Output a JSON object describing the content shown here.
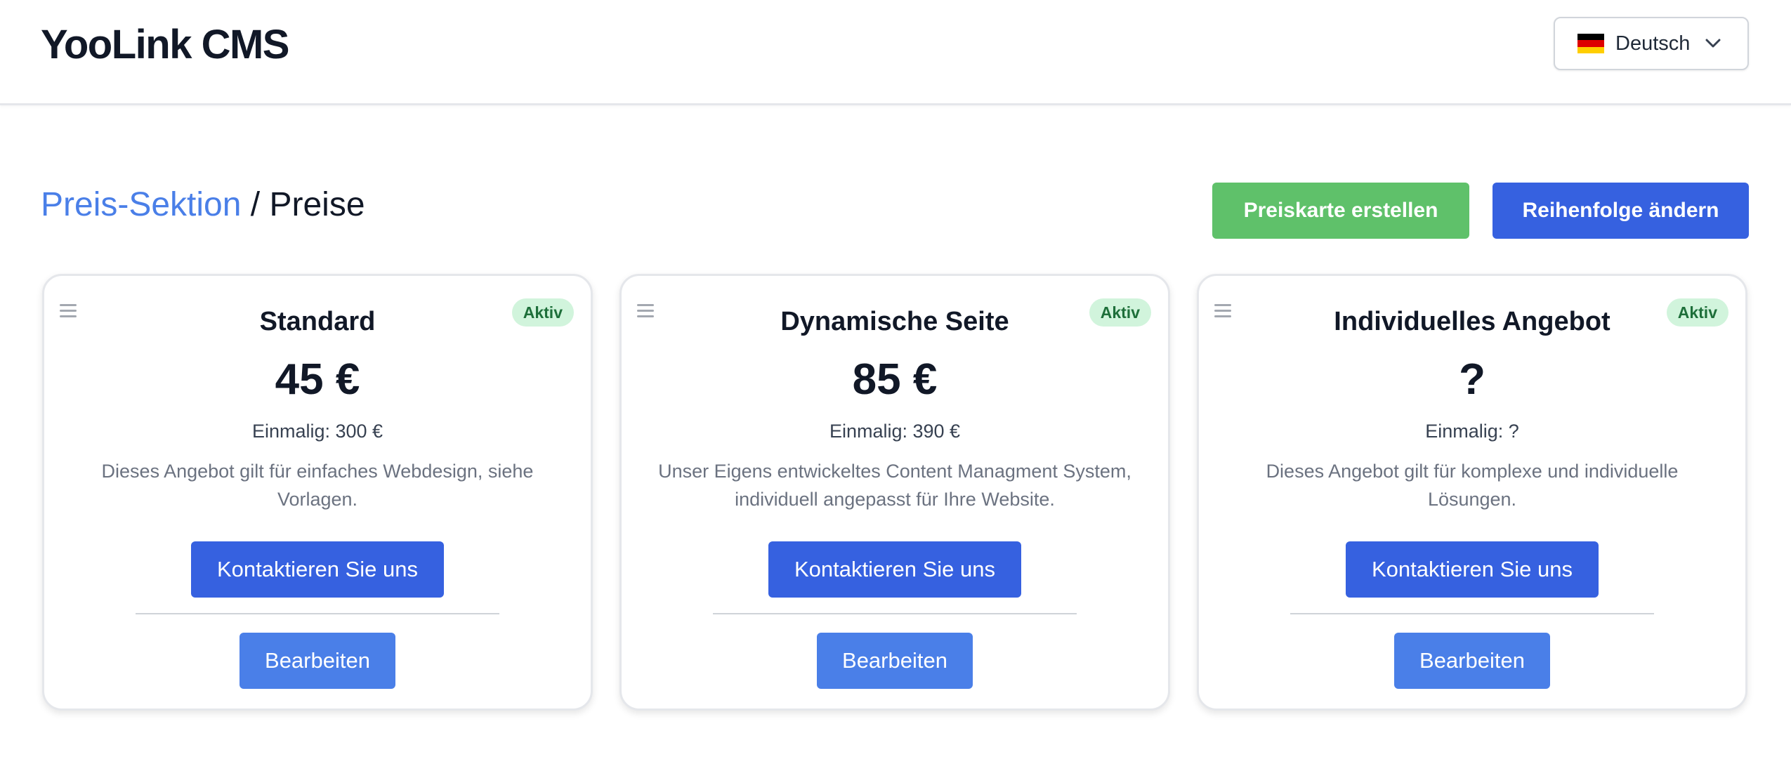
{
  "header": {
    "brand": "YooLink CMS",
    "language": {
      "selected": "Deutsch",
      "flag_colors": [
        "#000000",
        "#dd0000",
        "#ffce00"
      ],
      "icon": "chevron-down-icon"
    }
  },
  "breadcrumb": {
    "parent": "Preis-Sektion",
    "separator": " / ",
    "current": "Preise"
  },
  "actions": {
    "create_label": "Preiskarte erstellen",
    "reorder_label": "Reihenfolge ändern"
  },
  "colors": {
    "accent_blue": "#3661e0",
    "light_blue": "#4a7fe8",
    "create_green": "#5fc16a",
    "badge_bg": "#d1f4dc",
    "badge_text": "#1e6f3a"
  },
  "cards": [
    {
      "badge": "Aktiv",
      "title": "Standard",
      "price": "45 €",
      "once": "Einmalig: 300 €",
      "description": "Dieses Angebot gilt für einfaches Webdesign, siehe Vorlagen.",
      "contact_label": "Kontaktieren Sie uns",
      "edit_label": "Bearbeiten"
    },
    {
      "badge": "Aktiv",
      "title": "Dynamische Seite",
      "price": "85 €",
      "once": "Einmalig: 390 €",
      "description": "Unser Eigens entwickeltes Content Managment System, individuell angepasst für Ihre Website.",
      "contact_label": "Kontaktieren Sie uns",
      "edit_label": "Bearbeiten"
    },
    {
      "badge": "Aktiv",
      "title": "Individuelles Angebot",
      "price": "?",
      "once": "Einmalig: ?",
      "description": "Dieses Angebot gilt für komplexe und individuelle Lösungen.",
      "contact_label": "Kontaktieren Sie uns",
      "edit_label": "Bearbeiten"
    }
  ]
}
